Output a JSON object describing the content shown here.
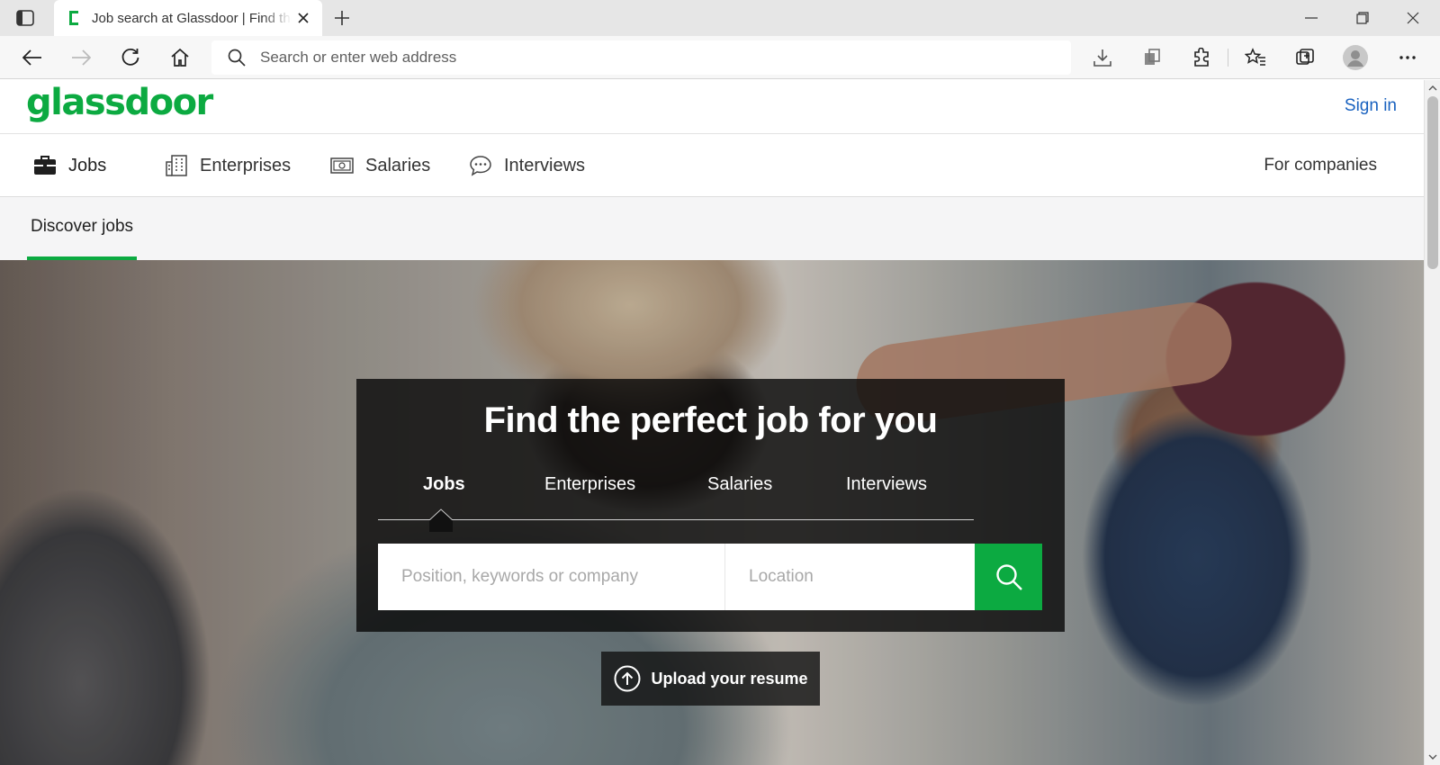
{
  "browser": {
    "tab_title": "Job search at Glassdoor | Find the",
    "address_placeholder": "Search or enter web address",
    "icons": {
      "sidebar": "tab-actions-icon",
      "favicon": "glassdoor-favicon",
      "close": "close-icon",
      "new_tab": "plus-icon",
      "back": "back-arrow-icon",
      "forward": "forward-arrow-icon",
      "refresh": "refresh-icon",
      "home": "home-icon",
      "search": "search-icon",
      "downloads": "download-icon",
      "collections_copy": "copy-icon",
      "extensions": "puzzle-icon",
      "favorites": "favorites-icon",
      "collections": "collections-icon",
      "profile": "avatar-icon",
      "menu": "more-icon"
    }
  },
  "header": {
    "logo": "glassdoor",
    "sign_in": "Sign in"
  },
  "mainnav": {
    "items": [
      {
        "label": "Jobs",
        "icon": "briefcase-icon"
      },
      {
        "label": "Enterprises",
        "icon": "building-icon"
      },
      {
        "label": "Salaries",
        "icon": "money-icon"
      },
      {
        "label": "Interviews",
        "icon": "chat-bubbles-icon"
      }
    ],
    "for_companies": "For companies"
  },
  "subnav": {
    "active_tab": "Discover jobs"
  },
  "hero": {
    "title": "Find the perfect job for you",
    "tabs": [
      "Jobs",
      "Enterprises",
      "Salaries",
      "Interviews"
    ],
    "active_tab": "Jobs",
    "keyword_placeholder": "Position, keywords or company",
    "location_placeholder": "Location",
    "upload_label": "Upload your resume"
  },
  "colors": {
    "brand_green": "#0caa41",
    "link_blue": "#1861bf"
  }
}
